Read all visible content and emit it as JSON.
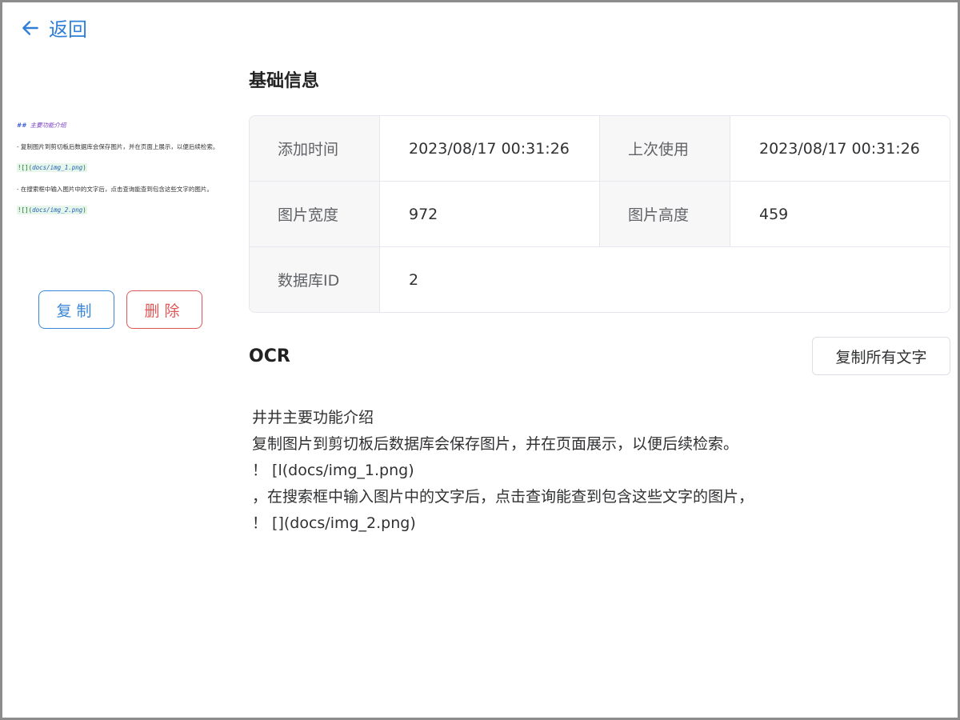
{
  "nav": {
    "back_label": "返回"
  },
  "preview": {
    "heading_marker": "##",
    "heading_text": "主要功能介绍",
    "line1": "- 复制图片到剪切板后数据库会保存图片，并在页面上展示，以便后续检索。",
    "code1_prefix": "![](",
    "code1_path": "docs/img_1.png",
    "code1_suffix": ")",
    "line2": "- 在搜索框中输入图片中的文字后，点击查询能查到包含这些文字的图片。",
    "code2_prefix": "![](",
    "code2_path": "docs/img_2.png",
    "code2_suffix": ")"
  },
  "actions": {
    "copy_label": "复制",
    "delete_label": "删除"
  },
  "info": {
    "title": "基础信息",
    "rows": [
      {
        "k1": "添加时间",
        "v1": "2023/08/17 00:31:26",
        "k2": "上次使用",
        "v2": "2023/08/17 00:31:26"
      },
      {
        "k1": "图片宽度",
        "v1": "972",
        "k2": "图片高度",
        "v2": "459"
      },
      {
        "k1": "数据库ID",
        "v1": "2"
      }
    ]
  },
  "ocr": {
    "title": "OCR",
    "copy_all_label": "复制所有文字",
    "lines": [
      "井井主要功能介绍",
      "复制图片到剪切板后数据库会保存图片，并在页面展示，以便后续检索。",
      "！ [l(docs/img_1.png)",
      "，在搜索框中输入图片中的文字后，点击查询能查到包含这些文字的图片，",
      "！ [](docs/img_2.png)"
    ]
  },
  "colors": {
    "accent": "#2f7fd8",
    "danger": "#e05757",
    "border": "#e4e7ed",
    "label_bg": "#f7f7f8"
  }
}
